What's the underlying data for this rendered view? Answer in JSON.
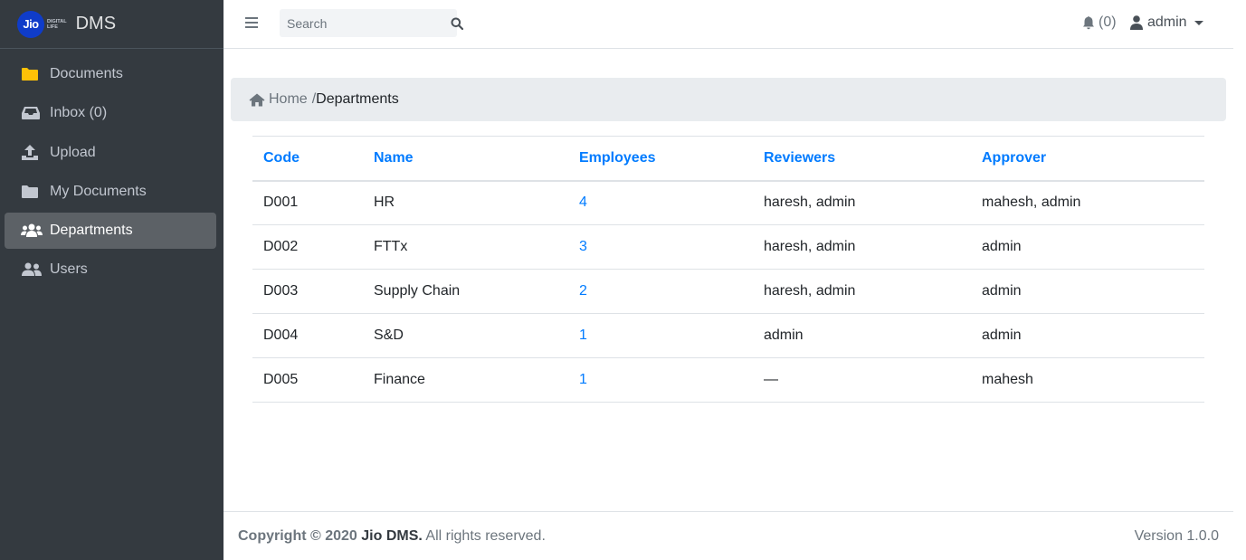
{
  "app": {
    "logo_text": "Jio",
    "logo_sub": [
      "DIGITAL",
      "LIFE"
    ],
    "brand": "DMS"
  },
  "sidebar": {
    "items": [
      {
        "label": "Documents",
        "icon": "folder-icon",
        "icon_color": "#ffc107"
      },
      {
        "label": "Inbox (0)",
        "icon": "inbox-icon"
      },
      {
        "label": "Upload",
        "icon": "upload-icon"
      },
      {
        "label": "My Documents",
        "icon": "folder-icon"
      },
      {
        "label": "Departments",
        "icon": "users-icon",
        "active": true
      },
      {
        "label": "Users",
        "icon": "user-friends-icon"
      }
    ]
  },
  "header": {
    "search_placeholder": "Search",
    "notifications": "(0)",
    "user": "admin"
  },
  "breadcrumb": {
    "home": "Home",
    "separator": "/",
    "current": "Departments"
  },
  "table": {
    "columns": [
      "Code",
      "Name",
      "Employees",
      "Reviewers",
      "Approver"
    ],
    "rows": [
      {
        "code": "D001",
        "name": "HR",
        "employees": "4",
        "reviewers": "haresh, admin",
        "approver": "mahesh, admin"
      },
      {
        "code": "D002",
        "name": "FTTx",
        "employees": "3",
        "reviewers": "haresh, admin",
        "approver": "admin"
      },
      {
        "code": "D003",
        "name": "Supply Chain",
        "employees": "2",
        "reviewers": "haresh, admin",
        "approver": "admin"
      },
      {
        "code": "D004",
        "name": "S&D",
        "employees": "1",
        "reviewers": "admin",
        "approver": "admin"
      },
      {
        "code": "D005",
        "name": "Finance",
        "employees": "1",
        "reviewers": "—",
        "approver": "mahesh"
      }
    ]
  },
  "footer": {
    "copyright": "Copyright © 2020",
    "brand": "Jio DMS.",
    "rights": "All rights reserved.",
    "version": "Version 1.0.0"
  },
  "colors": {
    "sidebar_bg": "#343a40",
    "link": "#007bff",
    "breadcrumb_bg": "#e9ecef",
    "logo_blue": "#0f3cc9"
  }
}
